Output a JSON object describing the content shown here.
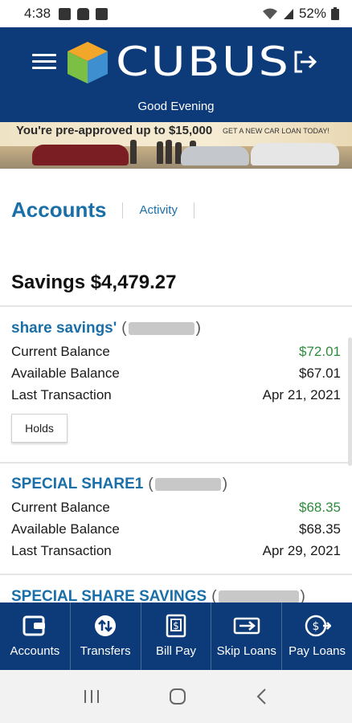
{
  "status_bar": {
    "time": "4:38",
    "battery": "52%"
  },
  "header": {
    "brand": "CUBUS",
    "greeting": "Good Evening"
  },
  "banner": {
    "headline": "You're pre-approved up to $15,000",
    "cta": "GET A NEW CAR LOAN TODAY!"
  },
  "nav": {
    "accounts_title": "Accounts",
    "activity_link": "Activity"
  },
  "savings": {
    "title": "Savings $4,479.27"
  },
  "accounts": [
    {
      "name": "share savings'",
      "rows": [
        {
          "label": "Current Balance",
          "value": "$72.01"
        },
        {
          "label": "Available Balance",
          "value": "$67.01"
        },
        {
          "label": "Last Transaction",
          "value": "Apr 21, 2021"
        }
      ],
      "holds_label": "Holds"
    },
    {
      "name": "SPECIAL SHARE1",
      "rows": [
        {
          "label": "Current Balance",
          "value": "$68.35"
        },
        {
          "label": "Available Balance",
          "value": "$68.35"
        },
        {
          "label": "Last Transaction",
          "value": "Apr 29, 2021"
        }
      ]
    },
    {
      "name": "SPECIAL SHARE SAVINGS"
    }
  ],
  "tabs": [
    {
      "label": "Accounts",
      "icon": "wallet-icon"
    },
    {
      "label": "Transfers",
      "icon": "transfer-arrows-icon"
    },
    {
      "label": "Bill Pay",
      "icon": "bill-icon"
    },
    {
      "label": "Skip Loans",
      "icon": "skip-loan-icon"
    },
    {
      "label": "Pay Loans",
      "icon": "pay-loan-icon"
    }
  ],
  "colors": {
    "brand_navy": "#0d3a78",
    "link_blue": "#1a6fa8",
    "positive_green": "#2e8b3d"
  }
}
